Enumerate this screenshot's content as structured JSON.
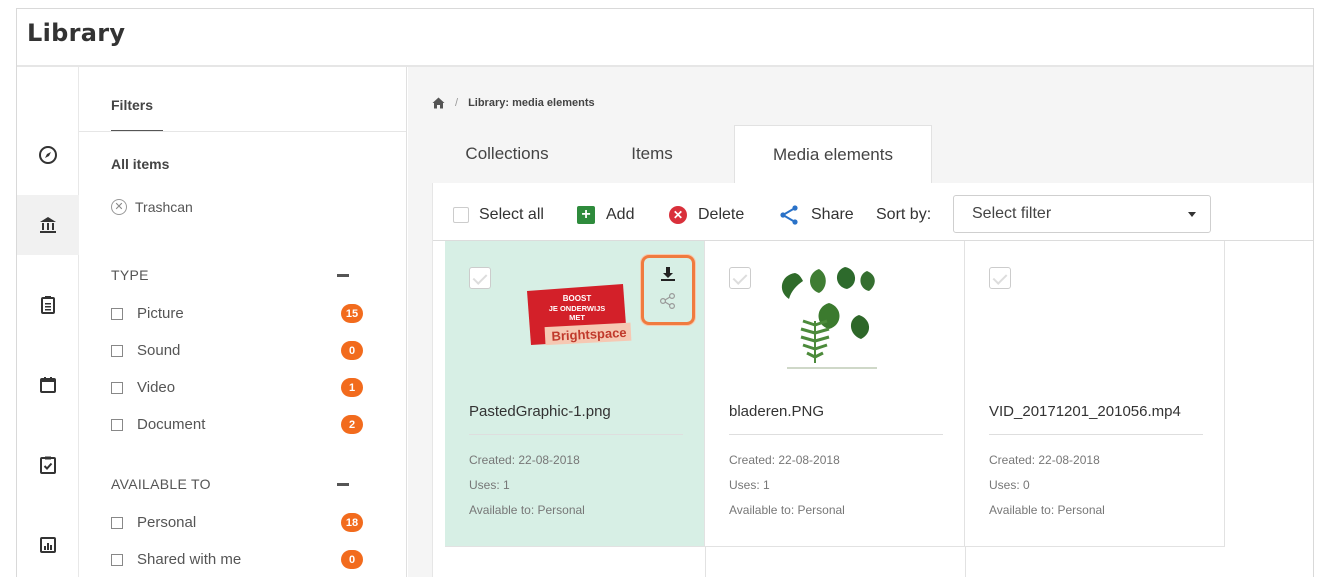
{
  "app": {
    "title": "Library"
  },
  "rail": {
    "icons": [
      "compass-icon",
      "library-icon",
      "clipboard-icon",
      "calendar-icon",
      "checklist-icon",
      "chart-icon"
    ]
  },
  "filters": {
    "tab_label": "Filters",
    "all_items_label": "All items",
    "trashcan_label": "Trashcan",
    "type_section": {
      "heading": "TYPE",
      "items": [
        {
          "label": "Picture",
          "count": "15"
        },
        {
          "label": "Sound",
          "count": "0"
        },
        {
          "label": "Video",
          "count": "1"
        },
        {
          "label": "Document",
          "count": "2"
        }
      ]
    },
    "available_section": {
      "heading": "AVAILABLE TO",
      "items": [
        {
          "label": "Personal",
          "count": "18"
        },
        {
          "label": "Shared with me",
          "count": "0"
        }
      ]
    },
    "badge_color": "#f26b1d"
  },
  "breadcrumb": {
    "separator": "/",
    "current": "Library: media elements"
  },
  "tabs": [
    {
      "label": "Collections"
    },
    {
      "label": "Items"
    },
    {
      "label": "Media elements",
      "active": true
    }
  ],
  "toolbar": {
    "select_all_label": "Select all",
    "add_label": "Add",
    "delete_label": "Delete",
    "share_label": "Share",
    "sort_by_label": "Sort by:",
    "sort_select_value": "Select filter"
  },
  "cards": [
    {
      "name": "PastedGraphic-1.png",
      "created": "Created:  22-08-2018",
      "uses": "Uses:  1",
      "available": "Available to:  Personal",
      "selected": true,
      "thumb_lines": [
        "BOOST",
        "JE ONDERWIJS",
        "MET",
        "Brightspace"
      ]
    },
    {
      "name": "bladeren.PNG",
      "created": "Created:  22-08-2018",
      "uses": "Uses:  1",
      "available": "Available to:  Personal"
    },
    {
      "name": "VID_20171201_201056.mp4",
      "created": "Created:  22-08-2018",
      "uses": "Uses:  0",
      "available": "Available to:  Personal"
    }
  ],
  "colors": {
    "selected_card": "#d7efe5",
    "highlight": "#f07b3f",
    "add_green": "#2e8b3c",
    "delete_red": "#d9303b",
    "share_blue": "#2a72c8"
  }
}
